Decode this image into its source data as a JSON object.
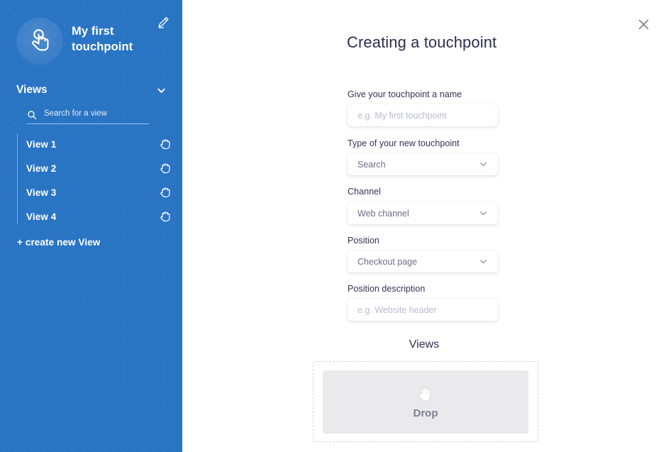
{
  "sidebar": {
    "brand": {
      "title": "My first\ntouchpoint",
      "logo_icon": "tap-hand-icon"
    },
    "edit_icon": "pencil-icon",
    "views_section": {
      "label": "Views",
      "chevron_icon": "chevron-down-icon"
    },
    "search": {
      "placeholder": "Search for a view",
      "value": "",
      "icon": "search-icon"
    },
    "items": [
      {
        "label": "View 1",
        "drag_icon": "grab-hand-icon"
      },
      {
        "label": "View 2",
        "drag_icon": "grab-hand-icon"
      },
      {
        "label": "View 3",
        "drag_icon": "grab-hand-icon"
      },
      {
        "label": "View 4",
        "drag_icon": "grab-hand-icon"
      }
    ],
    "create_view_label": "+ create new View",
    "accent_color": "#2a74c4"
  },
  "main": {
    "close_icon": "close-icon",
    "title": "Creating a touchpoint",
    "fields": {
      "name": {
        "label": "Give your touchpoint a name",
        "placeholder": "e.g. My first touchpoint",
        "value": ""
      },
      "type": {
        "label": "Type of your new touchpoint",
        "value": "Search",
        "chevron_icon": "chevron-down-icon"
      },
      "channel": {
        "label": "Channel",
        "value": "Web channel",
        "chevron_icon": "chevron-down-icon"
      },
      "position": {
        "label": "Position",
        "value": "Checkout page",
        "chevron_icon": "chevron-down-icon"
      },
      "position_description": {
        "label": "Position description",
        "placeholder": "e.g. Website header",
        "value": ""
      }
    },
    "views_heading": "Views",
    "dropzone": {
      "label": "Drop",
      "icon": "open-hand-icon"
    }
  }
}
